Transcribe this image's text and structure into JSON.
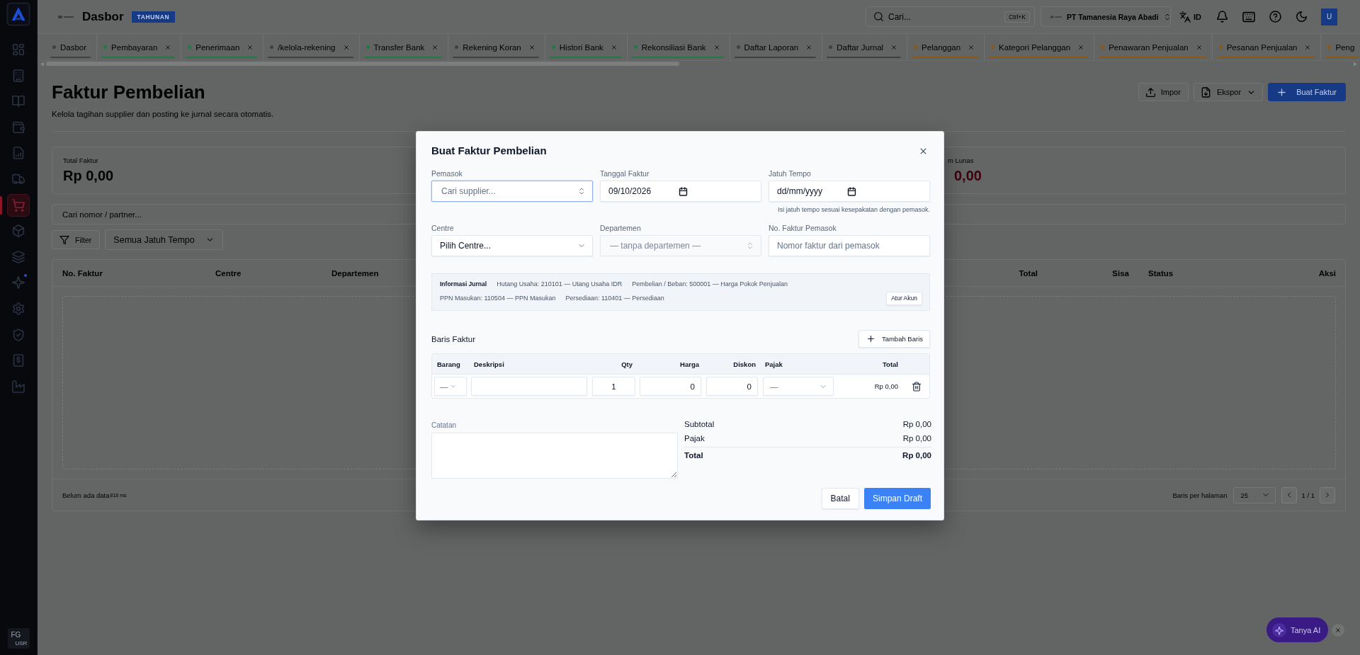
{
  "sidebar": {
    "items": [
      {
        "kind": "grid",
        "selected": false,
        "notify": false
      },
      {
        "kind": "building",
        "selected": false,
        "notify": false
      },
      {
        "kind": "book",
        "selected": false,
        "notify": false
      },
      {
        "kind": "wallet",
        "selected": false,
        "notify": false
      },
      {
        "kind": "report",
        "selected": false,
        "notify": false
      },
      {
        "kind": "truck",
        "selected": false,
        "notify": false
      },
      {
        "kind": "cart",
        "selected": true,
        "notify": false
      },
      {
        "kind": "box",
        "selected": false,
        "notify": false
      },
      {
        "kind": "layers",
        "selected": false,
        "notify": false
      },
      {
        "kind": "sparkles",
        "selected": false,
        "notify": true
      },
      {
        "kind": "gear",
        "selected": false,
        "notify": false
      },
      {
        "kind": "shield",
        "selected": false,
        "notify": false
      },
      {
        "kind": "money",
        "selected": false,
        "notify": false
      },
      {
        "kind": "factory",
        "selected": false,
        "notify": false
      }
    ],
    "user": {
      "initials": "FG",
      "role": "USR"
    }
  },
  "header": {
    "title": "Dasbor",
    "badge": "TAHUNAN",
    "search": {
      "placeholder": "Cari...",
      "shortcut": "Ctrl+K"
    },
    "company": "PT Tamanesia Raya Abadi",
    "language": "ID",
    "avatar": "U"
  },
  "tabs": [
    {
      "label": "Dasbor",
      "color": "#3e4042",
      "closable": false
    },
    {
      "label": "Pembayaran",
      "color": "#1f7a45",
      "closable": true
    },
    {
      "label": "Penerimaan",
      "color": "#1f7a45",
      "closable": true
    },
    {
      "label": "/kelola-rekening",
      "color": "#3e4042",
      "closable": true
    },
    {
      "label": "Transfer Bank",
      "color": "#1f7a45",
      "closable": true
    },
    {
      "label": "Rekening Koran",
      "color": "#3e4042",
      "closable": true
    },
    {
      "label": "Histori Bank",
      "color": "#1f7a45",
      "closable": true
    },
    {
      "label": "Rekonsiliasi Bank",
      "color": "#1f7a45",
      "closable": true
    },
    {
      "label": "Daftar Laporan",
      "color": "#3e4042",
      "closable": true
    },
    {
      "label": "Daftar Jurnal",
      "color": "#3e4042",
      "closable": true
    },
    {
      "label": "Pelanggan",
      "color": "#8a5a12",
      "closable": true
    },
    {
      "label": "Kategori Pelanggan",
      "color": "#8a5a12",
      "closable": true
    },
    {
      "label": "Penawaran Penjualan",
      "color": "#8a5a12",
      "closable": true
    },
    {
      "label": "Pesanan Penjualan",
      "color": "#8a5a12",
      "closable": true
    },
    {
      "label": "Peng",
      "color": "#8a5a12",
      "closable": false
    }
  ],
  "page": {
    "title": "Faktur Pembelian",
    "subtitle": "Kelola tagihan supplier dan posting ke jurnal secara otomatis.",
    "actions": [
      {
        "label": "Impor",
        "kind": "import"
      },
      {
        "label": "Ekspor",
        "kind": "export"
      },
      {
        "label": "Buat Faktur",
        "kind": "create"
      }
    ],
    "stats": [
      {
        "label": "Total Faktur",
        "value": "Rp 0,00",
        "kind": "neutral"
      },
      {
        "label": "m Lunas",
        "value": "0,00",
        "kind": "danger"
      }
    ],
    "search": {
      "placeholder": "Cari nomor / partner..."
    },
    "filter_button": "Filter",
    "due_filter": "Semua Jatuh Tempo",
    "table": {
      "columns": [
        {
          "label": "No. Faktur",
          "kind": "text"
        },
        {
          "label": "Centre",
          "kind": "text"
        },
        {
          "label": "Departemen",
          "kind": "text"
        },
        {
          "label": "Total",
          "kind": "numeric"
        },
        {
          "label": "Sisa",
          "kind": "numeric"
        },
        {
          "label": "Status",
          "kind": "text"
        },
        {
          "label": "Aksi",
          "kind": "action"
        }
      ],
      "empty_text": "Belum ada data",
      "timing": "818 ms",
      "rows_per_page_label": "Baris per halaman",
      "rows_per_page": "25",
      "page_indicator": "1 / 1"
    }
  },
  "modal": {
    "title": "Buat Faktur Pembelian",
    "fields": [
      {
        "label": "Pemasok",
        "kind": "combobox",
        "placeholder": "Cari supplier...",
        "focused": true,
        "disabled": false
      },
      {
        "label": "Tanggal Faktur",
        "kind": "date",
        "value": "09/10/2026",
        "focused": false,
        "disabled": false
      },
      {
        "label": "Jatuh Tempo",
        "kind": "date",
        "placeholder": "dd/mm/yyyy",
        "hint": "Isi jatuh tempo sesuai kesepakatan dengan pemasok.",
        "focused": false,
        "disabled": false
      },
      {
        "label": "Centre",
        "kind": "select",
        "value": "Pilih Centre...",
        "focused": false,
        "disabled": false
      },
      {
        "label": "Departemen",
        "kind": "combobox",
        "value": "— tanpa departemen —",
        "focused": false,
        "disabled": true
      },
      {
        "label": "No. Faktur Pemasok",
        "kind": "text",
        "placeholder": "Nomor faktur dari pemasok",
        "focused": false,
        "disabled": false
      }
    ],
    "journal": {
      "title": "Informasi Jurnal",
      "accounts": [
        "Hutang Usaha: 210101 — Utang Usaha IDR",
        "Pembelian / Beban: 500001 — Harga Pokok Penjualan",
        "PPN Masukan: 110504 — PPN Masukan",
        "Persediaan: 110401 — Persediaan"
      ],
      "button": "Atur Akun"
    },
    "lines": {
      "title": "Baris Faktur",
      "add_button": "Tambah Baris",
      "columns": [
        "Barang",
        "Deskripsi",
        "Qty",
        "Harga",
        "Diskon",
        "Pajak",
        "Total"
      ],
      "rows": [
        {
          "item": "—",
          "qty": "1",
          "price": "0",
          "discount": "0",
          "tax": "—",
          "total": "Rp 0,00"
        }
      ]
    },
    "notes": {
      "label": "Catatan"
    },
    "summary": [
      {
        "label": "Subtotal",
        "value": "Rp 0,00",
        "kind": "normal"
      },
      {
        "label": "Pajak",
        "value": "Rp 0,00",
        "kind": "normal"
      },
      {
        "label": "Total",
        "value": "Rp 0,00",
        "kind": "total"
      }
    ],
    "buttons": [
      {
        "label": "Batal",
        "kind": "secondary"
      },
      {
        "label": "Simpan Draft",
        "kind": "primary"
      }
    ]
  },
  "assistant": {
    "label": "Tanya AI"
  }
}
